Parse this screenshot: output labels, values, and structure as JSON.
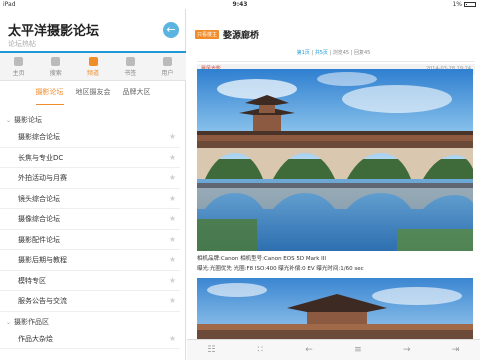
{
  "statusbar": {
    "device": "iPad",
    "time": "9:43",
    "battery": "1%"
  },
  "sidebar": {
    "title": "太平洋摄影论坛",
    "subtitle": "论坛热帖",
    "back_icon": "back-arrow-icon",
    "nav": [
      {
        "label": "主页",
        "icon": "home-icon",
        "active": false
      },
      {
        "label": "搜索",
        "icon": "search-icon",
        "active": false
      },
      {
        "label": "频道",
        "icon": "channel-icon",
        "active": true
      },
      {
        "label": "书签",
        "icon": "bookmark-icon",
        "active": false
      },
      {
        "label": "用户",
        "icon": "user-icon",
        "active": false
      }
    ],
    "subtabs": [
      "摄影论坛",
      "地区摄友会",
      "品牌大区"
    ],
    "groups": [
      {
        "title": "摄影论坛",
        "items": [
          "摄影综合论坛",
          "长焦与专业DC",
          "外拍活动与月赛",
          "镜头综合论坛",
          "摄像综合论坛",
          "摄影配件论坛",
          "摄影后期与教程",
          "模特专区",
          "服务公告与交流"
        ]
      },
      {
        "title": "摄影作品区",
        "items": [
          "作品大杂烩"
        ]
      }
    ]
  },
  "post": {
    "badge": "只看楼主",
    "title": "婺源廊桥",
    "meta": {
      "page": "第1页",
      "pages": "共5页",
      "views": "浏览45",
      "replies": "回复45"
    },
    "author": "晨风光影",
    "date": "2014-03-28 19:24",
    "exif_line1": "相机品牌:Canon 相机型号:Canon EOS 5D Mark III",
    "exif_line2": "曝光:光圈优先 光圈:F8 ISO:400 曝光补偿:0 EV 曝光时间:1/60 sec"
  },
  "toolbar": {
    "items": [
      "bookmark-add-icon",
      "grid-icon",
      "prev-page-icon",
      "list-icon",
      "next-page-icon",
      "last-page-icon"
    ]
  }
}
